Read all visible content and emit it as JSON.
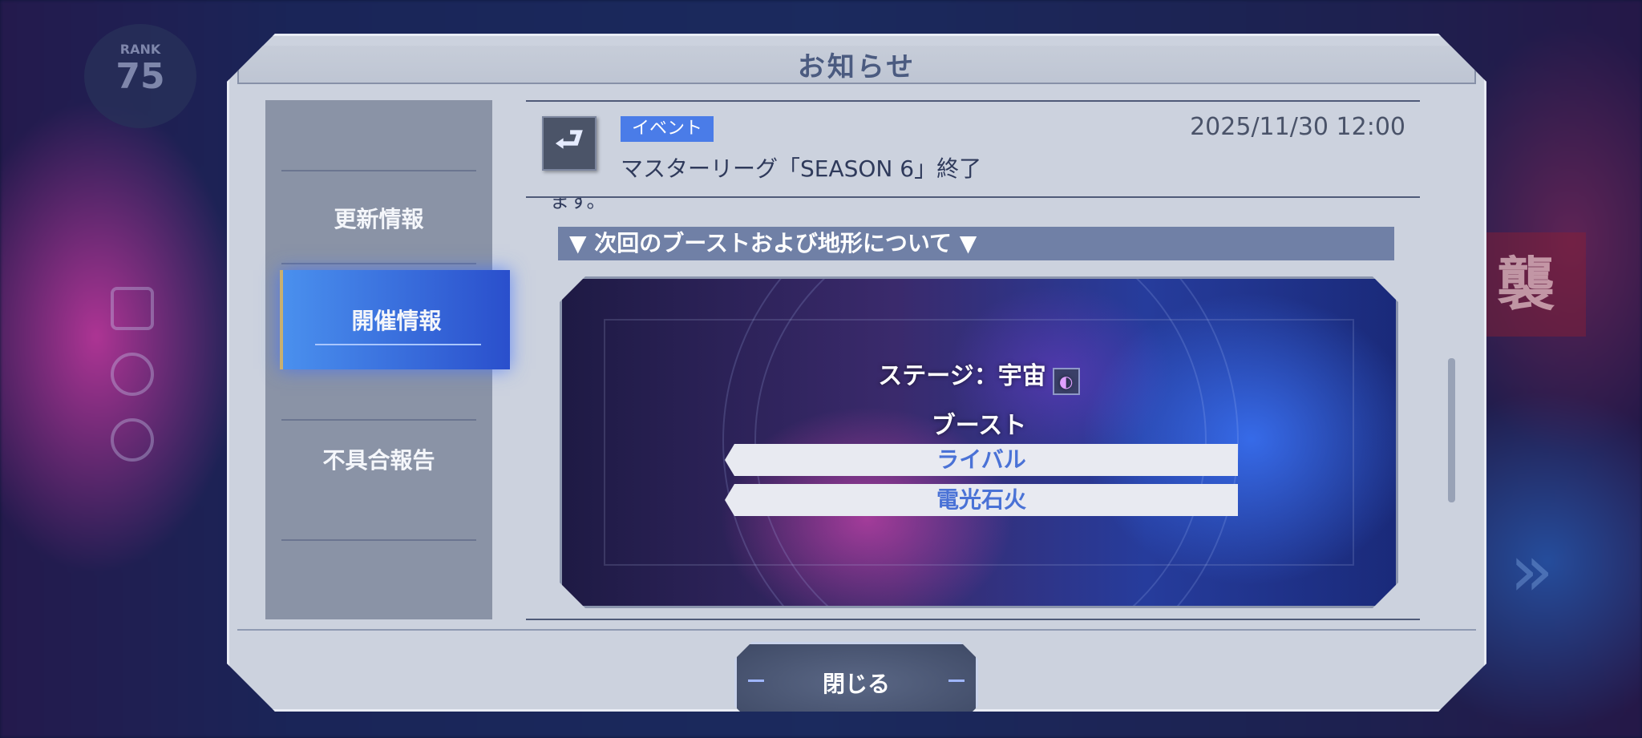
{
  "background": {
    "rank_label": "RANK",
    "rank_value": "75"
  },
  "dialog": {
    "title": "お知らせ"
  },
  "sidebar": {
    "items": [
      {
        "label": "更新情報",
        "active": false
      },
      {
        "label": "開催情報",
        "active": true
      },
      {
        "label": "不具合報告",
        "active": false
      }
    ]
  },
  "notice": {
    "icon": "return-arrow-icon",
    "tag": "イベント",
    "date": "2025/11/30 12:00",
    "title": "マスターリーグ「SEASON 6」終了",
    "cut_text": "ます。"
  },
  "content": {
    "section_heading": "▼ 次回のブーストおよび地形について ▼",
    "stage_label": "ステージ：宇宙",
    "stage_icon": "planet-icon",
    "boost_heading": "ブースト",
    "boosts": [
      "ライバル",
      "電光石火"
    ]
  },
  "footer": {
    "close_label": "閉じる"
  },
  "colors": {
    "accent": "#4a7ce8",
    "active_tab": "#3a6de0",
    "panel": "#ccd2de",
    "sidebar": "#8a93a6"
  }
}
